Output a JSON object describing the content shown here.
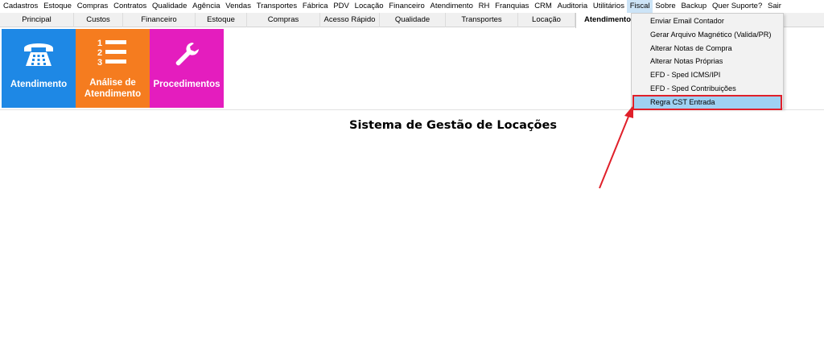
{
  "menubar": {
    "items": [
      "Cadastros",
      "Estoque",
      "Compras",
      "Contratos",
      "Qualidade",
      "Agência",
      "Vendas",
      "Transportes",
      "Fábrica",
      "PDV",
      "Locação",
      "Financeiro",
      "Atendimento",
      "RH",
      "Franquias",
      "CRM",
      "Auditoria",
      "Utilitários",
      "Fiscal",
      "Sobre",
      "Backup",
      "Quer Suporte?",
      "Sair"
    ],
    "active": "Fiscal"
  },
  "tabs": {
    "items": [
      "Principal",
      "Custos",
      "Financeiro",
      "Estoque",
      "Compras",
      "Acesso Rápido",
      "Qualidade",
      "Transportes",
      "Locação",
      "Atendimento"
    ],
    "active": "Atendimento"
  },
  "tiles": [
    {
      "label": "Atendimento",
      "icon": "telephone-icon",
      "color": "#1e88e5"
    },
    {
      "label": "Análise de Atendimento",
      "icon": "numbered-list-icon",
      "color": "#f57c1f"
    },
    {
      "label": "Procedimentos",
      "icon": "wrench-icon",
      "color": "#e41dbe"
    }
  ],
  "page_title": "Sistema de Gestão de Locações",
  "fiscal_menu": {
    "items": [
      "Enviar Email Contador",
      "Gerar Arquivo Magnético (Valida/PR)",
      "Alterar Notas de Compra",
      "Alterar Notas Próprias",
      "EFD - Sped ICMS/IPI",
      "EFD - Sped Contribuições",
      "Regra CST Entrada"
    ],
    "highlighted": "Regra CST Entrada",
    "highlight_color": "#e0202a"
  },
  "annotation": {
    "icon": "red-arrow-icon",
    "color": "#e0202a"
  }
}
